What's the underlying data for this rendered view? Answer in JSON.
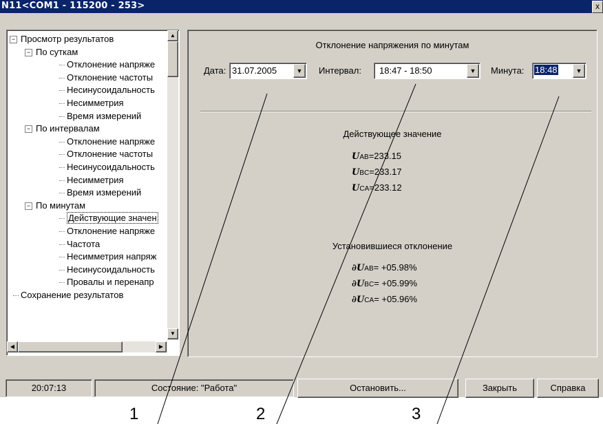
{
  "window": {
    "title": "N11<COM1 - 115200 - 253>",
    "close_label": "x"
  },
  "tree": {
    "nodes": [
      {
        "label": "Просмотр результатов"
      },
      {
        "label": "По суткам"
      },
      {
        "label": "Отклонение напряже"
      },
      {
        "label": "Отклонение частоты"
      },
      {
        "label": "Несинусоидальность"
      },
      {
        "label": "Несимметрия"
      },
      {
        "label": "Время измерений"
      },
      {
        "label": "По интервалам"
      },
      {
        "label": "Отклонение напряже"
      },
      {
        "label": "Отклонение частоты"
      },
      {
        "label": "Несинусоидальность"
      },
      {
        "label": "Несимметрия"
      },
      {
        "label": "Время измерений"
      },
      {
        "label": "По минутам"
      },
      {
        "label": "Действующие значен"
      },
      {
        "label": "Отклонение напряже"
      },
      {
        "label": "Частота"
      },
      {
        "label": "Несимметрия напряж"
      },
      {
        "label": "Несинусоидальность"
      },
      {
        "label": "Провалы и перенапр"
      },
      {
        "label": "Сохранение результатов"
      }
    ],
    "selected": "Действующие значен"
  },
  "panel": {
    "title": "Отклонение напряжения по минутам",
    "date_label": "Дата:",
    "date_value": "31.07.2005",
    "interval_label": "Интервал:",
    "interval_value": "18:47 - 18:50",
    "minute_label": "Минута:",
    "minute_value": "18:48",
    "rms_title": "Действующее значение",
    "rms": [
      {
        "symbol": "U",
        "sub": "AB",
        "value": "=233.15"
      },
      {
        "symbol": "U",
        "sub": "BC",
        "value": "=233.17"
      },
      {
        "symbol": "U",
        "sub": "CA",
        "value": "=233.12"
      }
    ],
    "dev_title": "Установившиеся отклонение",
    "dev": [
      {
        "symbol": "∂U",
        "sub": "AB",
        "value": "= +05.98%"
      },
      {
        "symbol": "∂U",
        "sub": "BC",
        "value": "= +05.99%"
      },
      {
        "symbol": "∂U",
        "sub": "CA",
        "value": "= +05.96%"
      }
    ]
  },
  "statusbar": {
    "time": "20:07:13",
    "state": "Состояние: \"Работа\"",
    "stop_label": "Остановить...",
    "close_label": "Закрыть",
    "help_label": "Справка"
  },
  "callouts": [
    "1",
    "2",
    "3"
  ]
}
